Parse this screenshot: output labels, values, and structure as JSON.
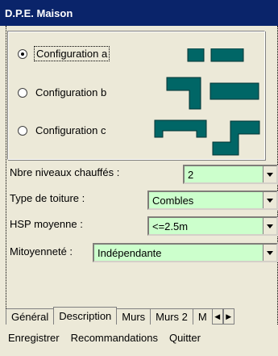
{
  "window": {
    "title": "D.P.E. Maison"
  },
  "configurations": [
    {
      "label": "Configuration a",
      "selected": true
    },
    {
      "label": "Configuration b",
      "selected": false
    },
    {
      "label": "Configuration c",
      "selected": false
    }
  ],
  "fields": {
    "niveaux": {
      "label": "Nbre niveaux chauffés :",
      "value": "2"
    },
    "toiture": {
      "label": "Type de toiture :",
      "value": "Combles"
    },
    "hsp": {
      "label": "HSP moyenne :",
      "value": "<=2.5m"
    },
    "mitoyennete": {
      "label": "Mitoyenneté :",
      "value": "Indépendante"
    }
  },
  "tabs": [
    "Général",
    "Description",
    "Murs",
    "Murs 2",
    "M"
  ],
  "active_tab": "Description",
  "menu": [
    "Enregistrer",
    "Recommandations",
    "Quitter"
  ],
  "colors": {
    "shape": "#006666",
    "combo_bg": "#ccffcc",
    "title_bg": "#0a246a"
  },
  "icons": {
    "dropdown": "chevron-down-icon",
    "tab_left": "arrow-left-icon",
    "tab_right": "arrow-right-icon"
  }
}
